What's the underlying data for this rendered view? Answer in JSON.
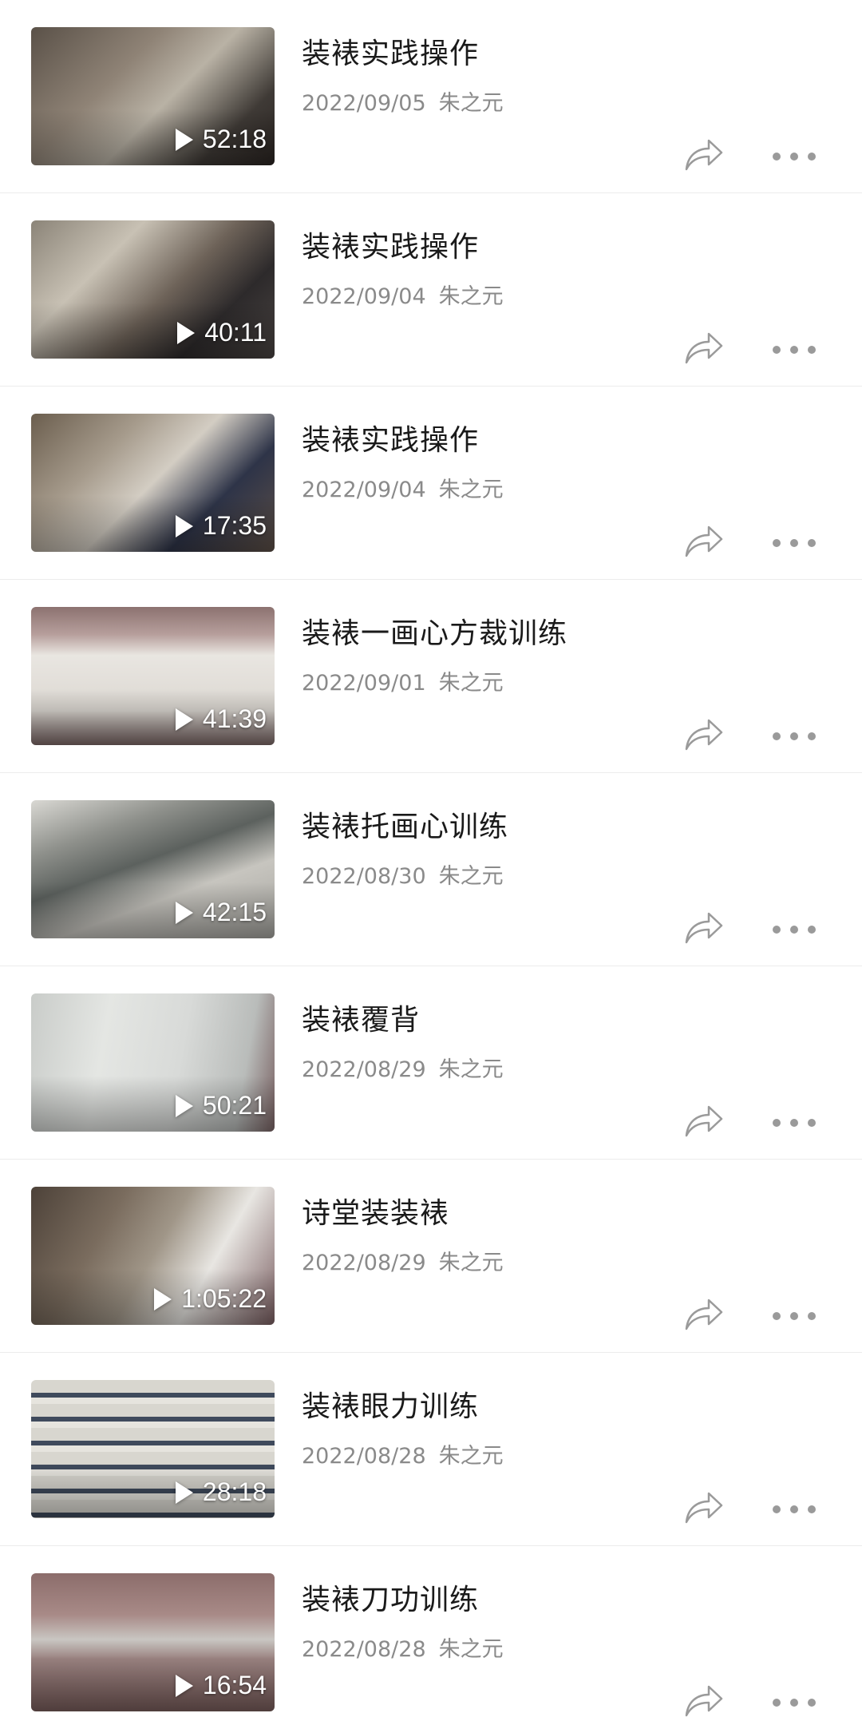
{
  "videos": [
    {
      "title": "装裱实践操作",
      "date": "2022/09/05",
      "author": "朱之元",
      "duration": "52:18"
    },
    {
      "title": "装裱实践操作",
      "date": "2022/09/04",
      "author": "朱之元",
      "duration": "40:11"
    },
    {
      "title": "装裱实践操作",
      "date": "2022/09/04",
      "author": "朱之元",
      "duration": "17:35"
    },
    {
      "title": "装裱一画心方裁训练",
      "date": "2022/09/01",
      "author": "朱之元",
      "duration": "41:39"
    },
    {
      "title": "装裱托画心训练",
      "date": "2022/08/30",
      "author": "朱之元",
      "duration": "42:15"
    },
    {
      "title": "装裱覆背",
      "date": "2022/08/29",
      "author": "朱之元",
      "duration": "50:21"
    },
    {
      "title": "诗堂装装裱",
      "date": "2022/08/29",
      "author": "朱之元",
      "duration": "1:05:22"
    },
    {
      "title": "装裱眼力训练",
      "date": "2022/08/28",
      "author": "朱之元",
      "duration": "28:18"
    },
    {
      "title": "装裱刀功训练",
      "date": "2022/08/28",
      "author": "朱之元",
      "duration": "16:54"
    }
  ],
  "icons": {
    "play": "play-icon",
    "share": "share-icon",
    "more": "more-icon"
  },
  "colors": {
    "title": "#1a1a1a",
    "meta": "#8a8a8a",
    "icon": "#9a9a9a",
    "divider": "#ececec"
  }
}
